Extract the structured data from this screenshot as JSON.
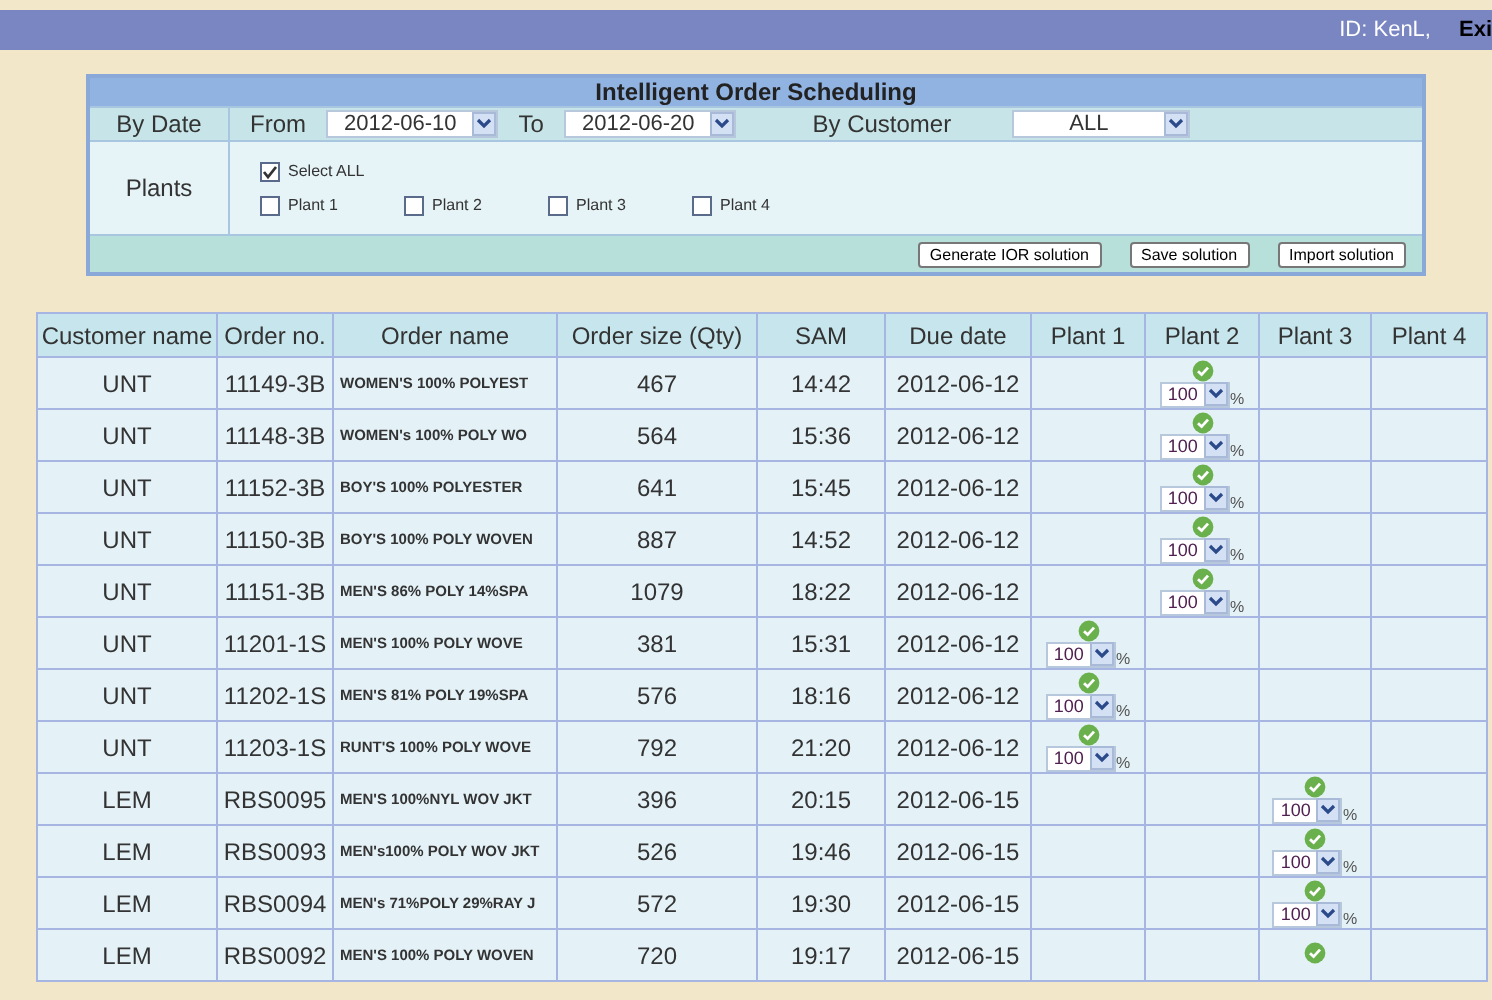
{
  "top_bar": {
    "user": "ID: KenL,",
    "exit": "Exi"
  },
  "panel": {
    "title": "Intelligent Order Scheduling",
    "date_filter": {
      "label": "By Date",
      "from_label": "From",
      "from": "2012-06-10",
      "to_label": "To",
      "to": "2012-06-20"
    },
    "customer_filter": {
      "label": "By Customer",
      "value": "ALL"
    },
    "plants": {
      "label": "Plants",
      "options": [
        {
          "label": "Select ALL",
          "checked": true
        },
        {
          "label": "Plant 1",
          "checked": false
        },
        {
          "label": "Plant 2",
          "checked": false
        },
        {
          "label": "Plant 3",
          "checked": false
        },
        {
          "label": "Plant 4",
          "checked": false
        }
      ]
    },
    "buttons": [
      "Generate IOR solution",
      "Save solution",
      "Import solution"
    ]
  },
  "table": {
    "columns": [
      "Customer name",
      "Order no.",
      "Order name",
      "Order size (Qty)",
      "SAM",
      "Due date",
      "Plant 1",
      "Plant 2",
      "Plant 3",
      "Plant 4"
    ],
    "rows": [
      {
        "customer": "UNT",
        "order_no": "11149-3B",
        "order_name": "WOMEN'S 100% POLYEST",
        "qty": "467",
        "sam": "14:42",
        "due": "2012-06-12",
        "allocations": [
          {
            "assigned": false
          },
          {
            "assigned": true,
            "value": "100",
            "unit": "%"
          },
          {
            "assigned": false
          },
          {
            "assigned": false
          }
        ]
      },
      {
        "customer": "UNT",
        "order_no": "11148-3B",
        "order_name": "WOMEN's 100% POLY WO",
        "qty": "564",
        "sam": "15:36",
        "due": "2012-06-12",
        "allocations": [
          {
            "assigned": false
          },
          {
            "assigned": true,
            "value": "100",
            "unit": "%"
          },
          {
            "assigned": false
          },
          {
            "assigned": false
          }
        ]
      },
      {
        "customer": "UNT",
        "order_no": "11152-3B",
        "order_name": "BOY'S 100% POLYESTER",
        "qty": "641",
        "sam": "15:45",
        "due": "2012-06-12",
        "allocations": [
          {
            "assigned": false
          },
          {
            "assigned": true,
            "value": "100",
            "unit": "%"
          },
          {
            "assigned": false
          },
          {
            "assigned": false
          }
        ]
      },
      {
        "customer": "UNT",
        "order_no": "11150-3B",
        "order_name": "BOY'S 100% POLY WOVEN",
        "qty": "887",
        "sam": "14:52",
        "due": "2012-06-12",
        "allocations": [
          {
            "assigned": false
          },
          {
            "assigned": true,
            "value": "100",
            "unit": "%"
          },
          {
            "assigned": false
          },
          {
            "assigned": false
          }
        ]
      },
      {
        "customer": "UNT",
        "order_no": "11151-3B",
        "order_name": "MEN'S 86% POLY 14%SPA",
        "qty": "1079",
        "sam": "18:22",
        "due": "2012-06-12",
        "allocations": [
          {
            "assigned": false
          },
          {
            "assigned": true,
            "value": "100",
            "unit": "%"
          },
          {
            "assigned": false
          },
          {
            "assigned": false
          }
        ]
      },
      {
        "customer": "UNT",
        "order_no": "11201-1S",
        "order_name": "MEN'S 100% POLY WOVE",
        "qty": "381",
        "sam": "15:31",
        "due": "2012-06-12",
        "allocations": [
          {
            "assigned": true,
            "value": "100",
            "unit": "%"
          },
          {
            "assigned": false
          },
          {
            "assigned": false
          },
          {
            "assigned": false
          }
        ]
      },
      {
        "customer": "UNT",
        "order_no": "11202-1S",
        "order_name": "MEN'S 81% POLY 19%SPA",
        "qty": "576",
        "sam": "18:16",
        "due": "2012-06-12",
        "allocations": [
          {
            "assigned": true,
            "value": "100",
            "unit": "%"
          },
          {
            "assigned": false
          },
          {
            "assigned": false
          },
          {
            "assigned": false
          }
        ]
      },
      {
        "customer": "UNT",
        "order_no": "11203-1S",
        "order_name": "RUNT'S 100% POLY WOVE",
        "qty": "792",
        "sam": "21:20",
        "due": "2012-06-12",
        "allocations": [
          {
            "assigned": true,
            "value": "100",
            "unit": "%"
          },
          {
            "assigned": false
          },
          {
            "assigned": false
          },
          {
            "assigned": false
          }
        ]
      },
      {
        "customer": "LEM",
        "order_no": "RBS0095",
        "order_name": "MEN'S 100%NYL WOV JKT",
        "qty": "396",
        "sam": "20:15",
        "due": "2012-06-15",
        "allocations": [
          {
            "assigned": false
          },
          {
            "assigned": false
          },
          {
            "assigned": true,
            "value": "100",
            "unit": "%"
          },
          {
            "assigned": false
          }
        ]
      },
      {
        "customer": "LEM",
        "order_no": "RBS0093",
        "order_name": "MEN's100% POLY WOV JKT",
        "qty": "526",
        "sam": "19:46",
        "due": "2012-06-15",
        "allocations": [
          {
            "assigned": false
          },
          {
            "assigned": false
          },
          {
            "assigned": true,
            "value": "100",
            "unit": "%"
          },
          {
            "assigned": false
          }
        ]
      },
      {
        "customer": "LEM",
        "order_no": "RBS0094",
        "order_name": "MEN's 71%POLY 29%RAY J",
        "qty": "572",
        "sam": "19:30",
        "due": "2012-06-15",
        "allocations": [
          {
            "assigned": false
          },
          {
            "assigned": false
          },
          {
            "assigned": true,
            "value": "100",
            "unit": "%"
          },
          {
            "assigned": false
          }
        ]
      },
      {
        "customer": "LEM",
        "order_no": "RBS0092",
        "order_name": "MEN'S 100% POLY WOVEN",
        "qty": "720",
        "sam": "19:17",
        "due": "2012-06-15",
        "allocations": [
          {
            "assigned": false
          },
          {
            "assigned": false
          },
          {
            "assigned": true
          },
          {
            "assigned": false
          }
        ]
      }
    ]
  }
}
